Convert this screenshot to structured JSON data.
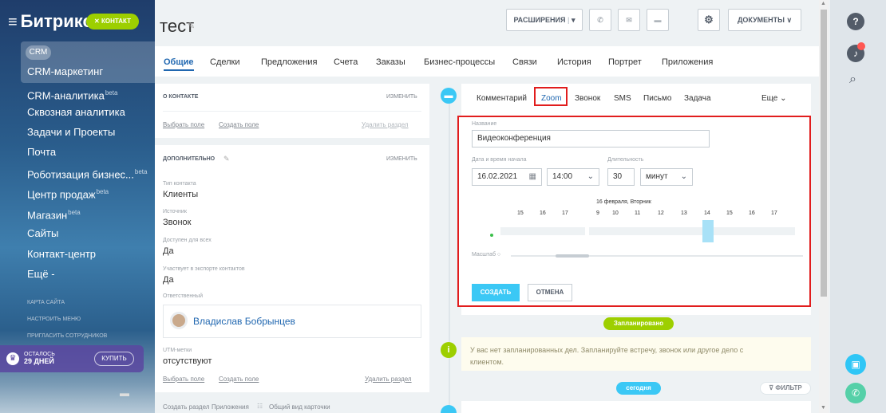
{
  "sidebar": {
    "menu_icon": "≡",
    "logo": "Битрикс",
    "contact_badge": "✕ КОНТАКТ",
    "crm_pill": "CRM",
    "items": [
      {
        "label": "CRM-маркетинг"
      },
      {
        "label": "CRM-аналитика",
        "sup": "beta"
      },
      {
        "label": "Сквозная аналитика"
      },
      {
        "label": "Задачи и Проекты"
      },
      {
        "label": "Почта"
      },
      {
        "label": "Роботизация бизнес...",
        "sup": "beta"
      },
      {
        "label": "Центр продаж",
        "sup": "beta"
      },
      {
        "label": "Магазин",
        "sup": "beta"
      },
      {
        "label": "Сайты"
      },
      {
        "label": "Контакт-центр"
      },
      {
        "label": "Ещё -"
      }
    ],
    "small_links": [
      "КАРТА САЙТА",
      "НАСТРОИТЬ МЕНЮ",
      "ПРИГЛАСИТЬ СОТРУДНИКОВ"
    ],
    "trial_line1": "ОСТАЛОСЬ",
    "trial_line2": "29 ДНЕЙ",
    "buy": "КУПИТЬ"
  },
  "header": {
    "title": "тест",
    "extensions": "РАСШИРЕНИЯ",
    "extensions_arrow": "▾",
    "documents": "ДОКУМЕНТЫ ∨"
  },
  "tabs": [
    "Общие",
    "Сделки",
    "Предложения",
    "Счета",
    "Заказы",
    "Бизнес-процессы",
    "Связи",
    "История",
    "Портрет",
    "Приложения"
  ],
  "about": {
    "title": "О КОНТАКТЕ",
    "edit": "изменить",
    "select_field": "Выбрать поле",
    "create_field": "Создать поле",
    "delete_section": "Удалить раздел"
  },
  "additional": {
    "title": "ДОПОЛНИТЕЛЬНО",
    "edit": "изменить",
    "fields": [
      {
        "label": "Тип контакта",
        "value": "Клиенты"
      },
      {
        "label": "Источник",
        "value": "Звонок"
      },
      {
        "label": "Доступен для всех",
        "value": "Да"
      },
      {
        "label": "Участвует в экспорте контактов",
        "value": "Да"
      }
    ],
    "responsible_label": "Ответственный",
    "responsible_name": "Владислав Бобрынцев",
    "utm_label": "UTM-метки",
    "utm_value": "отсутствуют",
    "select_field": "Выбрать поле",
    "create_field": "Создать поле",
    "delete_section": "Удалить раздел"
  },
  "bottom_links": [
    "Создать раздел",
    "Приложения",
    "Общий вид карточки"
  ],
  "editor": {
    "tabs": [
      "Комментарий",
      "Zoom",
      "Звонок",
      "SMS",
      "Письмо",
      "Задача"
    ],
    "more": "Еще ⌄"
  },
  "form": {
    "name_label": "Название",
    "name_value": "Видеоконференция",
    "date_label": "Дата и время начала",
    "date_value": "16.02.2021",
    "time_value": "14:00",
    "duration_label": "Длительность",
    "duration_value": "30",
    "unit_value": "минут",
    "day_label": "16 февраля, Вторник",
    "hours_left": [
      "15",
      "16",
      "17"
    ],
    "hours_right": [
      "9",
      "10",
      "11",
      "12",
      "13",
      "14",
      "15",
      "16",
      "17"
    ],
    "scale_label": "Масштаб",
    "create": "СОЗДАТЬ",
    "cancel": "ОТМЕНА"
  },
  "timeline": {
    "planned": "Запланировано",
    "empty_text": "У вас нет запланированных дел. Запланируйте встречу, звонок или другое дело с клиентом.",
    "today": "сегодня",
    "filter": "ФИЛЬТР"
  },
  "colors": {
    "accent": "#2067b0",
    "green": "#9dcf00",
    "cyan": "#3bc8f5",
    "red": "#e11d1d"
  }
}
